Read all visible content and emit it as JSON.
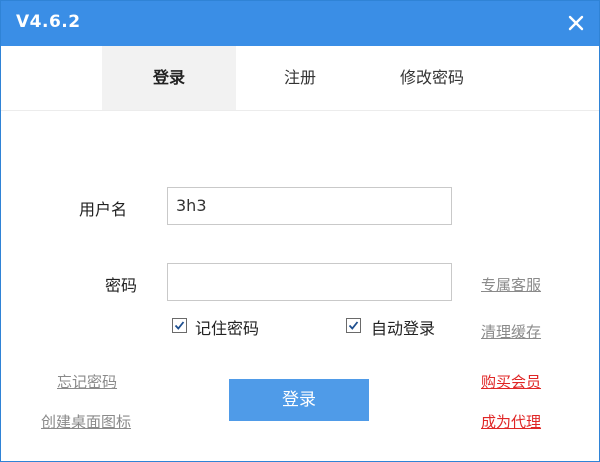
{
  "window": {
    "title": "V4.6.2"
  },
  "tabs": [
    {
      "label": "登录",
      "active": true
    },
    {
      "label": "注册",
      "active": false
    },
    {
      "label": "修改密码",
      "active": false
    }
  ],
  "form": {
    "username_label": "用户名",
    "username_value": "3h3",
    "password_label": "密码",
    "password_value": "",
    "remember_label": "记住密码",
    "remember_checked": true,
    "autologin_label": "自动登录",
    "autologin_checked": true,
    "login_button": "登录"
  },
  "links": {
    "support": "专属客服",
    "clear_cache": "清理缓存",
    "forgot_password": "忘记密码",
    "desktop_icon": "创建桌面图标",
    "buy_vip": "购买会员",
    "become_agent": "成为代理"
  },
  "colors": {
    "titlebar": "#3a8ee6",
    "button": "#4f9be8",
    "link_red": "#e02626",
    "link_gray": "#8a8a8a"
  },
  "icons": {
    "close": "close-icon",
    "check": "checkmark-icon"
  }
}
